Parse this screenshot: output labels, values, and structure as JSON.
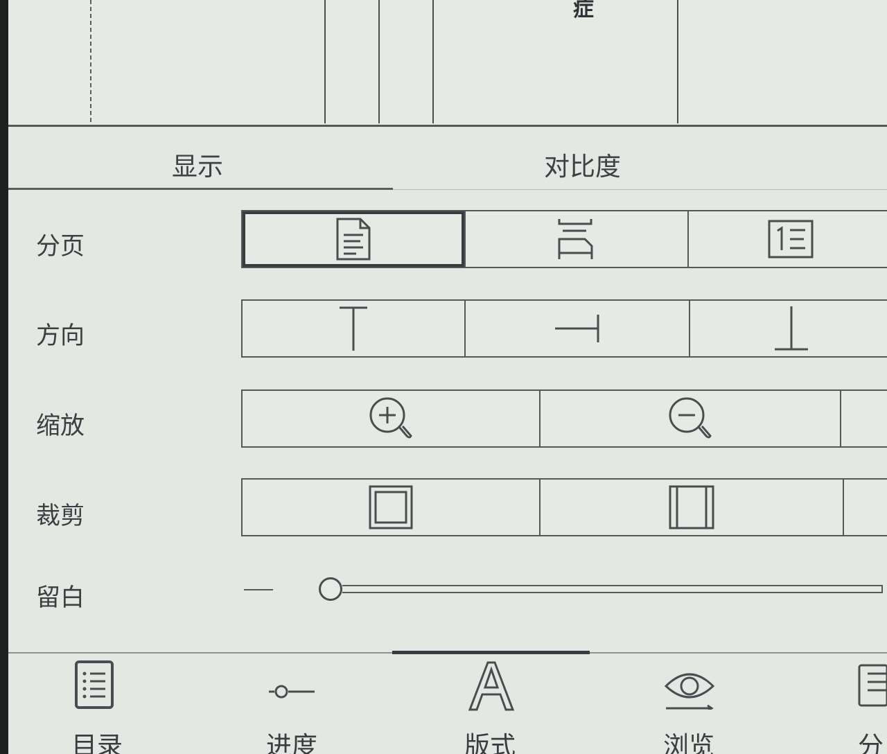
{
  "document_preview": {
    "visible_glyph": "症"
  },
  "settings": {
    "tabs": [
      {
        "label": "显示",
        "active": true
      },
      {
        "label": "对比度",
        "active": false
      }
    ],
    "rows": {
      "paging": {
        "label": "分页",
        "options": [
          "single-page-icon",
          "split-page-icon",
          "numbered-page-icon"
        ],
        "selected": 0
      },
      "orientation": {
        "label": "方向",
        "options": [
          "rotate-top-icon",
          "rotate-right-icon",
          "rotate-bottom-icon"
        ]
      },
      "zoom": {
        "label": "缩放",
        "options": [
          "zoom-in-icon",
          "zoom-out-icon"
        ]
      },
      "crop": {
        "label": "裁剪",
        "options": [
          "crop-auto-icon",
          "crop-sides-icon"
        ]
      },
      "margin": {
        "label": "留白",
        "decrease_symbol": "—",
        "level": 0
      }
    }
  },
  "bottom_nav": {
    "items": [
      {
        "label": "目录",
        "icon": "toc-icon"
      },
      {
        "label": "进度",
        "icon": "progress-icon"
      },
      {
        "label": "版式",
        "icon": "layout-icon",
        "active": true
      },
      {
        "label": "浏览",
        "icon": "browse-icon"
      },
      {
        "label": "分",
        "icon": "split-icon"
      }
    ]
  }
}
